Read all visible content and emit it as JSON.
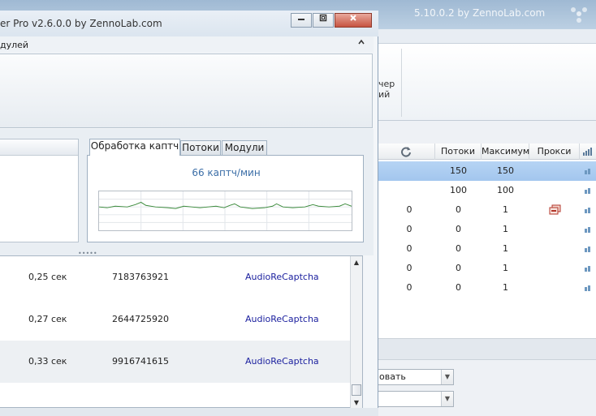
{
  "back_window": {
    "title": "ZennoPoster v5.10.0.2 by ZennoLab.com",
    "title_visible": "5.10.0.2 by ZennoLab.com",
    "ribbon_label_line1": "чер",
    "ribbon_label_line2": "ий",
    "grid": {
      "headers": [
        "Потоки",
        "Максимум",
        "Прокси"
      ],
      "rows": [
        {
          "c1": "",
          "threads": "150",
          "max": "150",
          "proxy": false,
          "selected": true
        },
        {
          "c1": "",
          "threads": "100",
          "max": "100",
          "proxy": false,
          "selected": false
        },
        {
          "c1": "0",
          "threads": "0",
          "max": "1",
          "proxy": true,
          "selected": false
        },
        {
          "c1": "0",
          "threads": "0",
          "max": "1",
          "proxy": false,
          "selected": false
        },
        {
          "c1": "0",
          "threads": "0",
          "max": "1",
          "proxy": false,
          "selected": false
        },
        {
          "c1": "0",
          "threads": "0",
          "max": "1",
          "proxy": false,
          "selected": false
        },
        {
          "c1": "0",
          "threads": "0",
          "max": "1",
          "proxy": false,
          "selected": false
        }
      ]
    },
    "combo1_value": "овать",
    "combo2_value": ""
  },
  "front_window": {
    "title": "er Pro v2.6.0.0 by ZennoLab.com",
    "modules_label": "дулей",
    "tabs": [
      {
        "label": "Обработка каптч",
        "active": true
      },
      {
        "label": "Потоки",
        "active": false
      },
      {
        "label": "Модули",
        "active": false
      }
    ],
    "rate_text": "66 каптч/мин",
    "grip": "•••••",
    "list": [
      {
        "time": "0,25 сек",
        "id": "7183763921",
        "module": "AudioReCaptcha"
      },
      {
        "time": "0,27 сек",
        "id": "2644725920",
        "module": "AudioReCaptcha"
      },
      {
        "time": "0,33 сек",
        "id": "9916741615",
        "module": "AudioReCaptcha"
      }
    ]
  },
  "colors": {
    "selection": "#a8c9ef",
    "chart_line": "#3a8a3a",
    "link": "#1a1f9e",
    "accent_text": "#3b6ea7"
  }
}
